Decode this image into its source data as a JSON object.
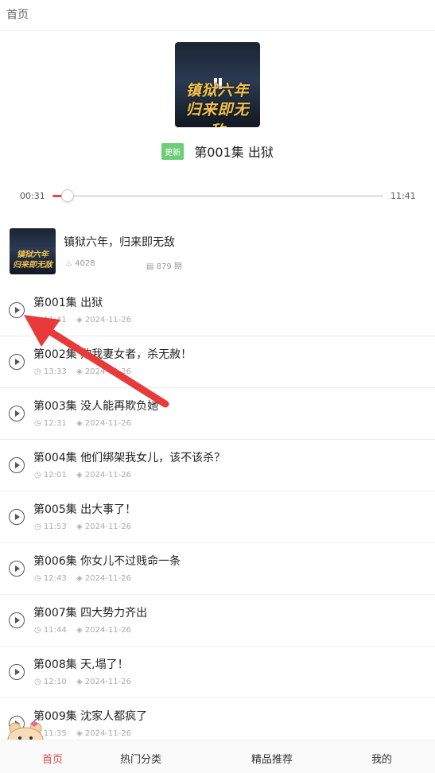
{
  "header": {
    "title": "首页"
  },
  "player": {
    "cover_line1": "镇狱六年",
    "cover_line2": "归来即无敌",
    "badge": "更新",
    "now_playing": "第001集 出狱",
    "current_time": "00:31",
    "total_time": "11:41",
    "progress_fraction": 0.044
  },
  "book": {
    "title": "镇狱六年，归来即无敌",
    "heat": "4028",
    "episodes": "879 期",
    "cover_line1": "镇狱六年",
    "cover_line2": "归来即无敌"
  },
  "episodes": [
    {
      "title": "第001集 出狱",
      "duration": "11:41",
      "date": "2024-11-26"
    },
    {
      "title": "第002集 欺我妻女者，杀无赦！",
      "duration": "13:33",
      "date": "2024-11-26"
    },
    {
      "title": "第003集 没人能再欺负她",
      "duration": "12:31",
      "date": "2024-11-26"
    },
    {
      "title": "第004集 他们绑架我女儿，该不该杀？",
      "duration": "12:01",
      "date": "2024-11-26"
    },
    {
      "title": "第005集 出大事了！",
      "duration": "11:53",
      "date": "2024-11-26"
    },
    {
      "title": "第006集 你女儿不过贱命一条",
      "duration": "12:43",
      "date": "2024-11-26"
    },
    {
      "title": "第007集 四大势力齐出",
      "duration": "11:44",
      "date": "2024-11-26"
    },
    {
      "title": "第008集 天,塌了！",
      "duration": "12:10",
      "date": "2024-11-26"
    },
    {
      "title": "第009集 沈家人都疯了",
      "duration": "11:35",
      "date": "2024-11-26"
    }
  ],
  "tabs": [
    {
      "label": "首页",
      "active": true
    },
    {
      "label": "热门分类",
      "active": false
    },
    {
      "label": "精品推荐",
      "active": false
    },
    {
      "label": "我的",
      "active": false
    }
  ],
  "colors": {
    "accent": "#e84848",
    "badge": "#6ccf76",
    "annotation_arrow": "#e83a3a"
  }
}
